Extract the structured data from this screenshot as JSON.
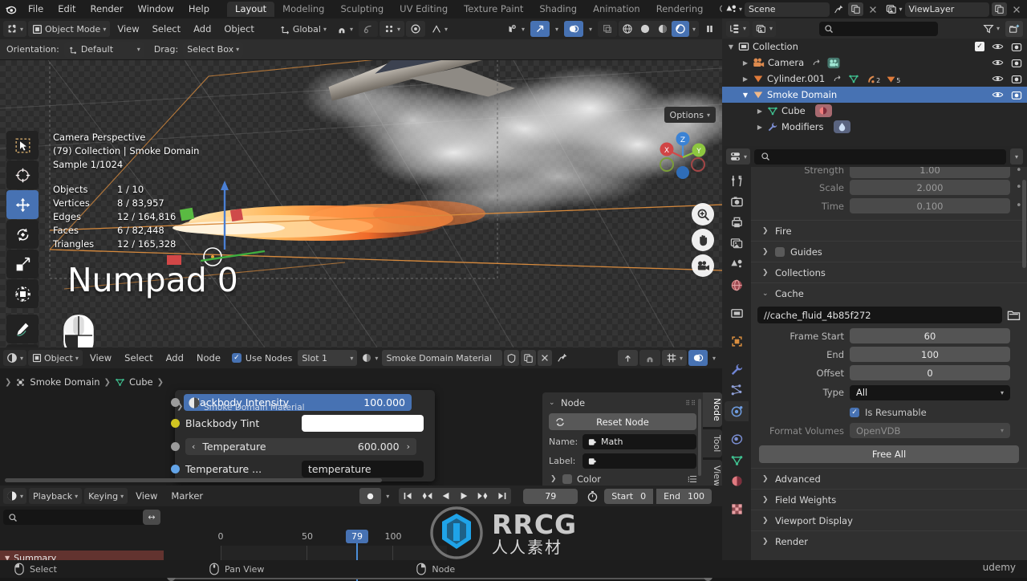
{
  "topbar": {
    "app_icon": "blender-logo-icon",
    "menus": [
      "File",
      "Edit",
      "Render",
      "Window",
      "Help"
    ],
    "workspace_tabs": [
      "Layout",
      "Modeling",
      "Sculpting",
      "UV Editing",
      "Texture Paint",
      "Shading",
      "Animation",
      "Rendering",
      "Compositing"
    ],
    "active_workspace": "Layout"
  },
  "viewport": {
    "header": {
      "editor_type_icon": "editor-type-3dview-icon",
      "mode": "Object Mode",
      "menus": [
        "View",
        "Select",
        "Add",
        "Object"
      ],
      "transform_orientation": "Global",
      "snap_icon": "magnet-icon",
      "proportional_icon": "proportional-edit-icon",
      "pivot_icon": "pivot-point-icon",
      "view_icon": "view-object-types-icon",
      "gizmo_icon": "gizmo-icon",
      "overlays_icon": "overlays-icon",
      "xray_icon": "xray-icon",
      "shading_modes": [
        "wireframe",
        "solid",
        "material-preview",
        "rendered"
      ],
      "active_shading": "rendered",
      "pause_icon": "pause-icon"
    },
    "subheader": {
      "orientation_label": "Orientation:",
      "orientation_value": "Default",
      "drag_label": "Drag:",
      "drag_value": "Select Box",
      "options_label": "Options"
    },
    "overlay_text": {
      "line1": "Camera Perspective",
      "line2": "(79) Collection | Smoke Domain",
      "line3": "Sample 1/1024"
    },
    "stats": [
      {
        "key": "Objects",
        "value": "1 / 10"
      },
      {
        "key": "Vertices",
        "value": "8 / 83,957"
      },
      {
        "key": "Edges",
        "value": "12 / 164,816"
      },
      {
        "key": "Faces",
        "value": "6 / 82,448"
      },
      {
        "key": "Triangles",
        "value": "12 / 165,328"
      }
    ],
    "annotation": "Numpad 0",
    "mouse_hint_icon": "mouse-middle-button-icon",
    "tools": [
      {
        "name": "tweak-select-box-tool",
        "icon": "select-box-icon",
        "active": false
      },
      {
        "name": "cursor-tool",
        "icon": "3d-cursor-icon",
        "active": false
      },
      {
        "name": "move-tool",
        "icon": "move-arrows-icon",
        "active": true
      },
      {
        "name": "rotate-tool",
        "icon": "rotate-icon",
        "active": false
      },
      {
        "name": "scale-tool",
        "icon": "scale-icon",
        "active": false
      },
      {
        "name": "transform-tool",
        "icon": "transform-icon",
        "active": false
      },
      {
        "name": "annotate-tool",
        "icon": "pencil-icon",
        "active": false
      },
      {
        "name": "measure-tool",
        "icon": "ruler-icon",
        "active": false
      },
      {
        "name": "add-cube-tool",
        "icon": "add-cube-icon",
        "active": false
      }
    ],
    "gizmo_axes": [
      "Z",
      "X",
      "Y"
    ],
    "nav_buttons": [
      "zoom-icon",
      "pan-hand-icon",
      "camera-view-icon"
    ]
  },
  "node_editor": {
    "header": {
      "editor_type_icon": "editor-type-shader-icon",
      "shader_type": "Object",
      "menus": [
        "View",
        "Select",
        "Add",
        "Node"
      ],
      "use_nodes_label": "Use Nodes",
      "use_nodes_checked": true,
      "slot": "Slot 1",
      "material_icon": "material-sphere-icon",
      "material_name": "Smoke Domain Material",
      "shield_icon": "fake-user-shield-icon",
      "copy_icon": "duplicate-icon",
      "close_icon": "x-icon",
      "pin_icon": "pin-icon",
      "up_icon": "arrow-up-icon",
      "snap_icon": "snap-magnet-icon",
      "snap_grid_icon": "snap-grid-icon",
      "overlay_icon": "node-overlay-icon"
    },
    "breadcrumb": [
      "Smoke Domain",
      "Cube",
      ""
    ],
    "popup_node": {
      "subtitle": "Smoke Domain Material",
      "rows": [
        {
          "label": "Blackbody Intensity",
          "value": "100.000",
          "socket": "#9b9b9b",
          "style": "highlight"
        },
        {
          "label": "Blackbody Tint",
          "value": "",
          "socket": "#d2c521",
          "style": "color"
        },
        {
          "label": "Temperature",
          "value": "600.000",
          "socket": "#9b9b9b",
          "style": "slider"
        },
        {
          "label": "Temperature ...",
          "value": "temperature",
          "socket": "#63a4e8",
          "style": "text"
        }
      ]
    },
    "sidebar": {
      "panel_title": "Node",
      "reset_button": "Reset Node",
      "reset_icon": "refresh-icon",
      "name_label": "Name:",
      "name_value": "Math",
      "label_label": "Label:",
      "label_value": "",
      "color_label": "Color",
      "tabs": [
        "Node",
        "Tool",
        "View"
      ],
      "active_tab": "Node"
    }
  },
  "timeline": {
    "editor_type_icon": "editor-type-timeline-icon",
    "menus": [
      "Playback",
      "Keying",
      "View",
      "Marker"
    ],
    "record_icon": "record-icon",
    "transport": [
      "jump-to-start-icon",
      "jump-prev-keyframe-icon",
      "play-reverse-icon",
      "play-icon",
      "jump-next-keyframe-icon",
      "jump-to-end-icon"
    ],
    "current_frame": "79",
    "timer_icon": "stopwatch-icon",
    "start_label": "Start",
    "start_value": "0",
    "end_label": "End",
    "end_value": "100",
    "search_placeholder": "",
    "summary_label": "Summary",
    "ticks": [
      "0",
      "50",
      "100"
    ],
    "playhead_frame": "79"
  },
  "outliner": {
    "scene_icon": "scene-icon",
    "scene_name": "Scene",
    "pin_icon": "pin-icon",
    "new_scene_icon": "new-scene-icon",
    "close_icon": "x-icon",
    "viewlayer_icon": "viewlayer-icon",
    "viewlayer_name": "ViewLayer",
    "display_mode_icon": "outliner-display-mode-icon",
    "filter_icon": "filter-funnel-icon",
    "new_collection_icon": "new-collection-icon",
    "search_placeholder": "",
    "rows": [
      {
        "name": "Collection",
        "icon": "collection-icon",
        "indent": 0,
        "expanded": true,
        "selected": false,
        "checkbox": true,
        "eye": true,
        "camera": true,
        "extras": []
      },
      {
        "name": "Camera",
        "icon": "camera-data-icon",
        "indent": 1,
        "expanded": false,
        "selected": false,
        "checkbox": false,
        "eye": true,
        "camera": true,
        "extras": [
          "camera-object-data-icon"
        ]
      },
      {
        "name": "Cylinder.001",
        "icon": "mesh-object-icon",
        "indent": 1,
        "expanded": false,
        "selected": false,
        "checkbox": false,
        "eye": true,
        "camera": true,
        "extras": [
          "mesh-data-icon",
          "modifier-icon-2",
          "particles-icon-5"
        ]
      },
      {
        "name": "Smoke Domain",
        "icon": "mesh-object-icon",
        "indent": 1,
        "expanded": true,
        "selected": true,
        "checkbox": false,
        "eye": true,
        "camera": true,
        "extras": []
      },
      {
        "name": "Cube",
        "icon": "mesh-data-icon",
        "indent": 2,
        "expanded": false,
        "selected": false,
        "checkbox": false,
        "eye": false,
        "camera": false,
        "extras": [
          "material-icon"
        ]
      },
      {
        "name": "Modifiers",
        "icon": "wrench-icon",
        "indent": 2,
        "expanded": false,
        "selected": false,
        "checkbox": false,
        "eye": false,
        "camera": false,
        "extras": [
          "fluid-modifier-icon"
        ]
      }
    ]
  },
  "properties": {
    "editor_icon": "properties-editor-icon",
    "search_placeholder": "",
    "collapse_icon": "chevron-down-icon",
    "tabs": [
      {
        "name": "tool-tab",
        "icon": "tool-screwdriver-wrench-icon",
        "active": false
      },
      {
        "name": "render-tab",
        "icon": "render-camera-back-icon",
        "active": false
      },
      {
        "name": "output-tab",
        "icon": "output-printer-icon",
        "active": false
      },
      {
        "name": "viewlayer-tab",
        "icon": "viewlayer-images-icon",
        "active": false
      },
      {
        "name": "scene-tab",
        "icon": "scene-cone-icon",
        "active": false
      },
      {
        "name": "world-tab",
        "icon": "world-globe-icon",
        "active": false
      },
      {
        "name": "collection-tab",
        "icon": "collection-box-icon",
        "active": false
      },
      {
        "name": "object-tab",
        "icon": "object-square-icon",
        "active": false
      },
      {
        "name": "modifier-tab",
        "icon": "wrench-icon",
        "active": false
      },
      {
        "name": "particles-tab",
        "icon": "particles-icon",
        "active": false
      },
      {
        "name": "physics-tab",
        "icon": "physics-orbit-icon",
        "active": true
      },
      {
        "name": "constraints-tab",
        "icon": "constraints-icon",
        "active": false
      },
      {
        "name": "data-tab",
        "icon": "mesh-data-triangle-icon",
        "active": false
      },
      {
        "name": "material-tab",
        "icon": "material-sphere-icon",
        "active": false
      },
      {
        "name": "texture-tab",
        "icon": "texture-checker-icon",
        "active": false
      }
    ],
    "top_fields": [
      {
        "label": "Strength",
        "value": "1.00",
        "dim": true
      },
      {
        "label": "Scale",
        "value": "2.000",
        "dim": true
      },
      {
        "label": "Time",
        "value": "0.100",
        "dim": true
      }
    ],
    "sections": [
      {
        "label": "Fire",
        "open": false,
        "checkbox": false
      },
      {
        "label": "Guides",
        "open": false,
        "checkbox": true
      },
      {
        "label": "Collections",
        "open": false,
        "checkbox": false
      },
      {
        "label": "Cache",
        "open": true,
        "checkbox": false
      }
    ],
    "cache": {
      "path": "//cache_fluid_4b85f272",
      "folder_icon": "folder-icon",
      "frame_start_label": "Frame Start",
      "frame_start_value": "60",
      "end_label": "End",
      "end_value": "100",
      "offset_label": "Offset",
      "offset_value": "0",
      "type_label": "Type",
      "type_value": "All",
      "is_resumable_label": "Is Resumable",
      "is_resumable_checked": true,
      "format_volumes_label": "Format Volumes",
      "format_volumes_value": "OpenVDB",
      "free_all_label": "Free All"
    },
    "bottom_sections": [
      {
        "label": "Advanced",
        "open": false
      },
      {
        "label": "Field Weights",
        "open": false
      },
      {
        "label": "Viewport Display",
        "open": false
      },
      {
        "label": "Render",
        "open": false
      }
    ]
  },
  "statusbar": {
    "items": [
      {
        "icon": "mouse-left-button-icon",
        "label": "Select"
      },
      {
        "icon": "mouse-middle-button-icon",
        "label": "Pan View"
      },
      {
        "icon": "mouse-right-button-icon",
        "label": "Node"
      }
    ],
    "brand": "udemy"
  },
  "watermark": {
    "main": "RRCG",
    "sub": "人人素材"
  },
  "colors": {
    "accent_blue": "#4772b3",
    "header_bg": "#252525",
    "panel_bg": "#303030",
    "editor_bg": "#1d1d1d",
    "field_bg": "#545454",
    "dark_field": "#151515",
    "summary_red": "#62332f"
  }
}
